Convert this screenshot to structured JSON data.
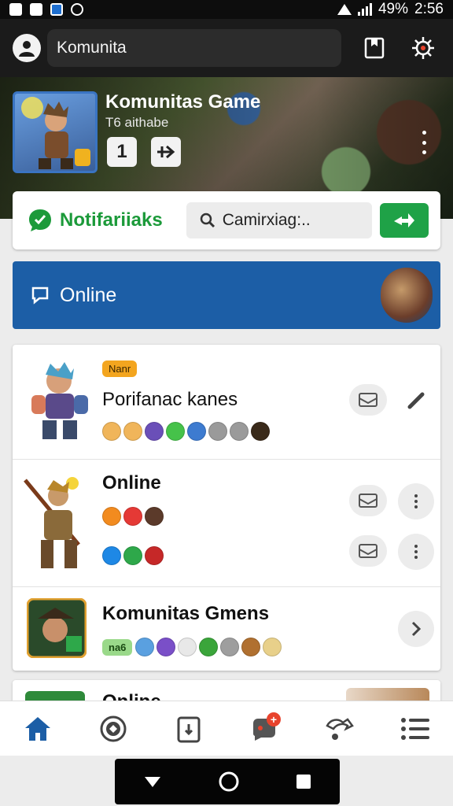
{
  "status_bar": {
    "battery": "49%",
    "time": "2:56"
  },
  "app_bar": {
    "title": "Komunita"
  },
  "hero": {
    "title": "Komunitas Game",
    "subtitle": "T6 aithabe",
    "button_count": "1"
  },
  "notifications": {
    "label": "Notifariiaks",
    "search_placeholder": "Camirxiag:.."
  },
  "online_banner": {
    "label": "Online"
  },
  "list": [
    {
      "tag": "Nanr",
      "title": "Porifanac kanes",
      "chip_colors": [
        "#f0b55a",
        "#f0b55a",
        "#6a4fb8",
        "#46c24a",
        "#3d7bd0",
        "#9a9a9a",
        "#9a9a9a",
        "#3a2a1a"
      ]
    },
    {
      "title": "Online",
      "chip_colors_row1": [
        "#f28b1f",
        "#e53935",
        "#5b3a2a"
      ],
      "chip_colors_row2": [
        "#1e88e5",
        "#2ea84a",
        "#c62828"
      ]
    },
    {
      "title": "Komunitas Gmens",
      "tag": "na6",
      "chip_colors": [
        "#5aa0e0",
        "#7a4fc8",
        "#e8e8e8",
        "#3aa53a",
        "#9e9e9e",
        "#b07030",
        "#e8d08a"
      ]
    }
  ],
  "partial_card": {
    "title": "Online"
  },
  "bottom_nav": {
    "items": [
      "home-icon",
      "sync-icon",
      "clipboard-icon",
      "chat-icon",
      "share-icon",
      "list-icon"
    ],
    "badge": "+"
  },
  "colors": {
    "accent_blue": "#1c5ea6",
    "accent_green": "#1fa247",
    "notif_green": "#1c9a3a"
  }
}
